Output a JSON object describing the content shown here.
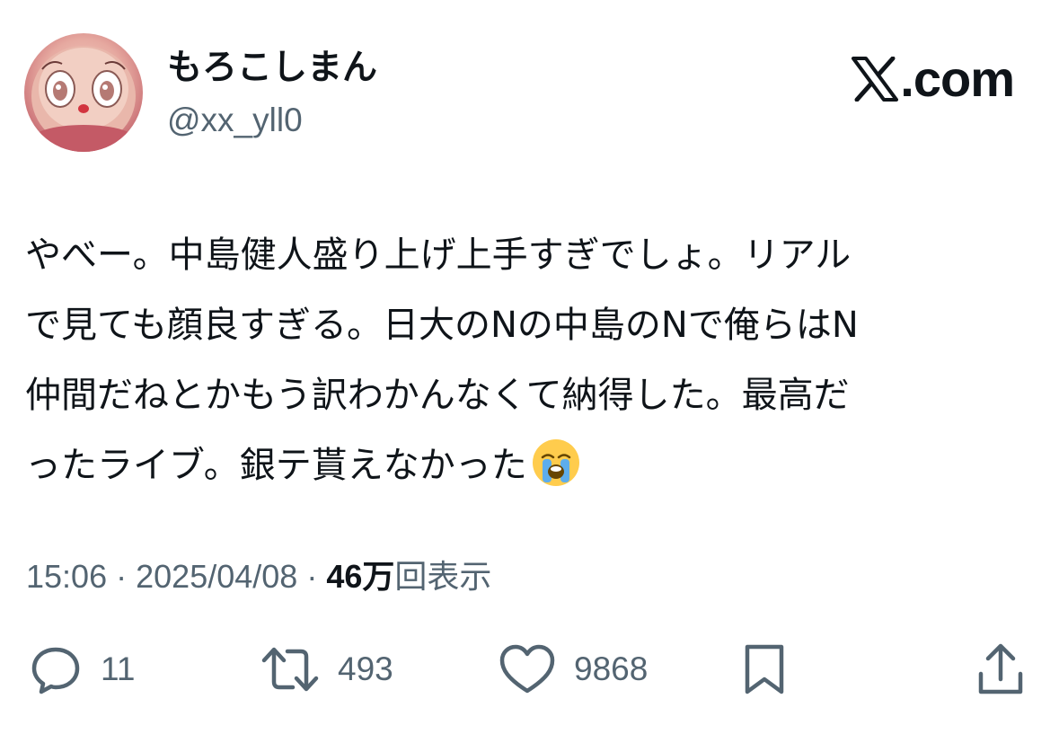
{
  "user": {
    "display_name": "もろこしまん",
    "handle": "@xx_yll0",
    "avatar_icon": "avatar-figurine"
  },
  "site": {
    "badge_text": ".com",
    "logo_icon": "x-logo-icon"
  },
  "tweet": {
    "lines": [
      "やべー。中島健人盛り上げ上手すぎでしょ。リアル",
      "で見ても顔良すぎる。日大のNの中島のNで俺らはN",
      "仲間だねとかもう訳わかんなくて納得した。最高だ",
      "ったライブ。銀テ貰えなかった"
    ],
    "emoji": "loudly-crying-face-emoji"
  },
  "meta": {
    "time": "15:06",
    "separator": "·",
    "date": "2025/04/08",
    "views_count": "46万",
    "views_label": "回表示"
  },
  "actions": {
    "reply": {
      "icon": "reply-icon",
      "count": "11"
    },
    "retweet": {
      "icon": "retweet-icon",
      "count": "493"
    },
    "like": {
      "icon": "heart-icon",
      "count": "9868"
    },
    "bookmark": {
      "icon": "bookmark-icon"
    },
    "share": {
      "icon": "share-icon"
    }
  },
  "colors": {
    "text_primary": "#0f1419",
    "text_secondary": "#536471",
    "background": "#ffffff"
  }
}
